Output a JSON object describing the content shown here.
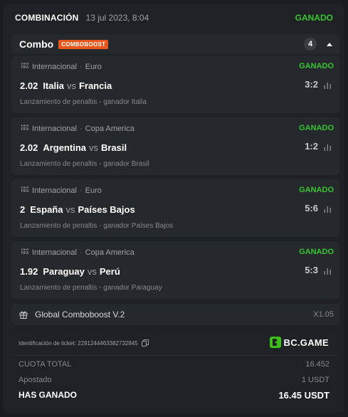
{
  "header": {
    "title": "COMBINACIÓN",
    "date": "13 jul 2023, 8:04",
    "status": "GANADO"
  },
  "combo": {
    "name": "Combo",
    "badge": "COMBOBOOST",
    "count": "4"
  },
  "bets": [
    {
      "fifa": "FIFA",
      "category": "Internacional",
      "tournament": "Euro",
      "result": "GANADO",
      "odd": "2.02",
      "home": "Italia",
      "vs": "vs",
      "away": "Francia",
      "score": "3:2",
      "market": "Lanzamiento de penaltis - ganador Italia"
    },
    {
      "fifa": "FIFA",
      "category": "Internacional",
      "tournament": "Copa America",
      "result": "GANADO",
      "odd": "2.02",
      "home": "Argentina",
      "vs": "vs",
      "away": "Brasil",
      "score": "1:2",
      "market": "Lanzamiento de penaltis - ganador Brasil"
    },
    {
      "fifa": "FIFA",
      "category": "Internacional",
      "tournament": "Euro",
      "result": "GANADO",
      "odd": "2",
      "home": "España",
      "vs": "vs",
      "away": "Países Bajos",
      "score": "5:6",
      "market": "Lanzamiento de penaltis - ganador Países Bajos"
    },
    {
      "fifa": "FIFA",
      "category": "Internacional",
      "tournament": "Copa America",
      "result": "GANADO",
      "odd": "1.92",
      "home": "Paraguay",
      "vs": "vs",
      "away": "Perú",
      "score": "5:3",
      "market": "Lanzamiento de penaltis - ganador Paraguay"
    }
  ],
  "comboboost": {
    "label": "Global Comboboost V.2",
    "multiplier": "X1.05"
  },
  "ticket": {
    "label": "Identificación de ticket: 2291244463382732845"
  },
  "brand": {
    "name": "BC.GAME"
  },
  "summary": {
    "odds_label": "CUOTA TOTAL",
    "odds_value": "16.452",
    "stake_label": "Apostado",
    "stake_value": "1 USDT",
    "win_label": "HAS GANADO",
    "win_value": "16.45 USDT"
  },
  "colors": {
    "background": "#1a1c1f",
    "card": "#1f2124",
    "panel": "#26292c",
    "win_green": "#36c531",
    "badge_orange": "#e8561c",
    "brand_green": "#3bc117"
  }
}
